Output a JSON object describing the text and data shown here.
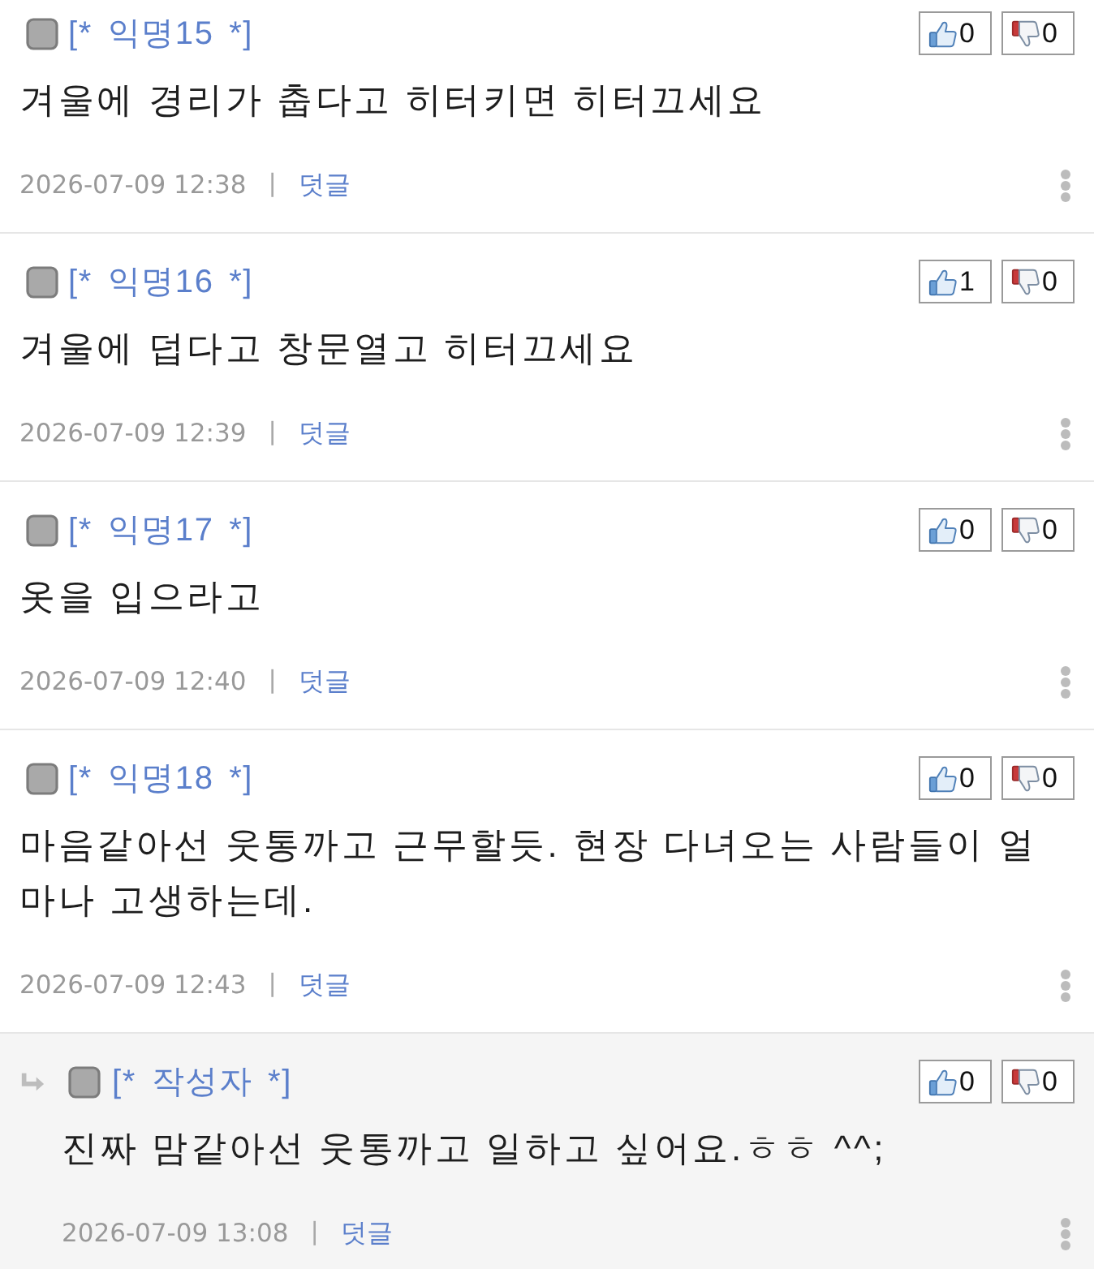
{
  "comments": [
    {
      "kind": "comment",
      "author": "[* 익명15 *]",
      "likes": "0",
      "dislikes": "0",
      "body": "겨울에 경리가 춥다고 히터키면 히터끄세요",
      "date": "2026-07-09 12:38",
      "separator": "|",
      "reply_label": "덧글"
    },
    {
      "kind": "comment",
      "author": "[* 익명16 *]",
      "likes": "1",
      "dislikes": "0",
      "body": "겨울에 덥다고 창문열고 히터끄세요",
      "date": "2026-07-09 12:39",
      "separator": "|",
      "reply_label": "덧글"
    },
    {
      "kind": "comment",
      "author": "[* 익명17 *]",
      "likes": "0",
      "dislikes": "0",
      "body": "옷을 입으라고",
      "date": "2026-07-09 12:40",
      "separator": "|",
      "reply_label": "덧글"
    },
    {
      "kind": "comment",
      "author": "[* 익명18 *]",
      "likes": "0",
      "dislikes": "0",
      "body": "마음같아선 웃통까고 근무할듯. 현장 다녀오는 사람들이 얼마나 고생하는데.",
      "date": "2026-07-09 12:43",
      "separator": "|",
      "reply_label": "덧글"
    },
    {
      "kind": "reply",
      "author": "[* 작성자 *]",
      "likes": "0",
      "dislikes": "0",
      "body": "진짜 맘같아선 웃통까고 일하고 싶어요.ㅎㅎ ^^;",
      "date": "2026-07-09 13:08",
      "separator": "|",
      "reply_label": "덧글"
    }
  ]
}
